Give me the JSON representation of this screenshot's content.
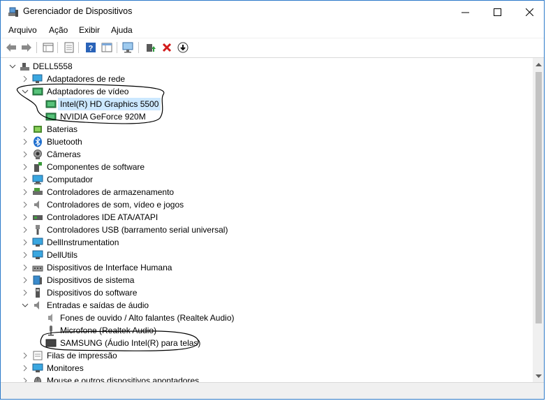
{
  "window": {
    "title": "Gerenciador de Dispositivos"
  },
  "menu": {
    "items": [
      "Arquivo",
      "Ação",
      "Exibir",
      "Ajuda"
    ]
  },
  "toolbar": {
    "buttons": [
      "back-icon",
      "forward-icon",
      "properties-grid-icon",
      "list-icon",
      "help-icon",
      "view-icon",
      "monitor-scan-icon",
      "update-driver-icon",
      "uninstall-icon",
      "download-icon"
    ]
  },
  "tree": {
    "root": "DELL5558",
    "categories": [
      {
        "label": "Adaptadores de rede",
        "icon": "network-icon",
        "expanded": false
      },
      {
        "label": "Adaptadores de vídeo",
        "icon": "display-adapter-icon",
        "expanded": true,
        "children": [
          "Intel(R) HD Graphics 5500",
          "NVIDIA GeForce 920M"
        ]
      },
      {
        "label": "Baterias",
        "icon": "battery-icon",
        "expanded": false
      },
      {
        "label": "Bluetooth",
        "icon": "bluetooth-icon",
        "expanded": false
      },
      {
        "label": "Câmeras",
        "icon": "camera-icon",
        "expanded": false
      },
      {
        "label": "Componentes de software",
        "icon": "software-component-icon",
        "expanded": false
      },
      {
        "label": "Computador",
        "icon": "computer-icon",
        "expanded": false
      },
      {
        "label": "Controladores de armazenamento",
        "icon": "storage-controller-icon",
        "expanded": false
      },
      {
        "label": "Controladores de som, vídeo e jogos",
        "icon": "sound-icon",
        "expanded": false
      },
      {
        "label": "Controladores IDE ATA/ATAPI",
        "icon": "ide-icon",
        "expanded": false
      },
      {
        "label": "Controladores USB (barramento serial universal)",
        "icon": "usb-icon",
        "expanded": false
      },
      {
        "label": "DellInstrumentation",
        "icon": "monitor-icon",
        "expanded": false
      },
      {
        "label": "DellUtils",
        "icon": "monitor-icon",
        "expanded": false
      },
      {
        "label": "Dispositivos de Interface Humana",
        "icon": "hid-icon",
        "expanded": false
      },
      {
        "label": "Dispositivos de sistema",
        "icon": "system-device-icon",
        "expanded": false
      },
      {
        "label": "Dispositivos do software",
        "icon": "software-device-icon",
        "expanded": false
      },
      {
        "label": "Entradas e saídas de áudio",
        "icon": "audio-icon",
        "expanded": true,
        "children": [
          "Fones de ouvido / Alto falantes (Realtek Audio)",
          "Microfone (Realtek Audio)",
          "SAMSUNG (Áudio Intel(R) para telas)"
        ]
      },
      {
        "label": "Filas de impressão",
        "icon": "print-queue-icon",
        "expanded": false
      },
      {
        "label": "Monitores",
        "icon": "monitor-icon",
        "expanded": false
      },
      {
        "label": "Mouse e outros dispositivos apontadores",
        "icon": "mouse-icon",
        "expanded": false
      }
    ],
    "selected": "Intel(R) HD Graphics 5500"
  },
  "colors": {
    "selection": "#cce8ff",
    "accent": "#2b79c9"
  }
}
